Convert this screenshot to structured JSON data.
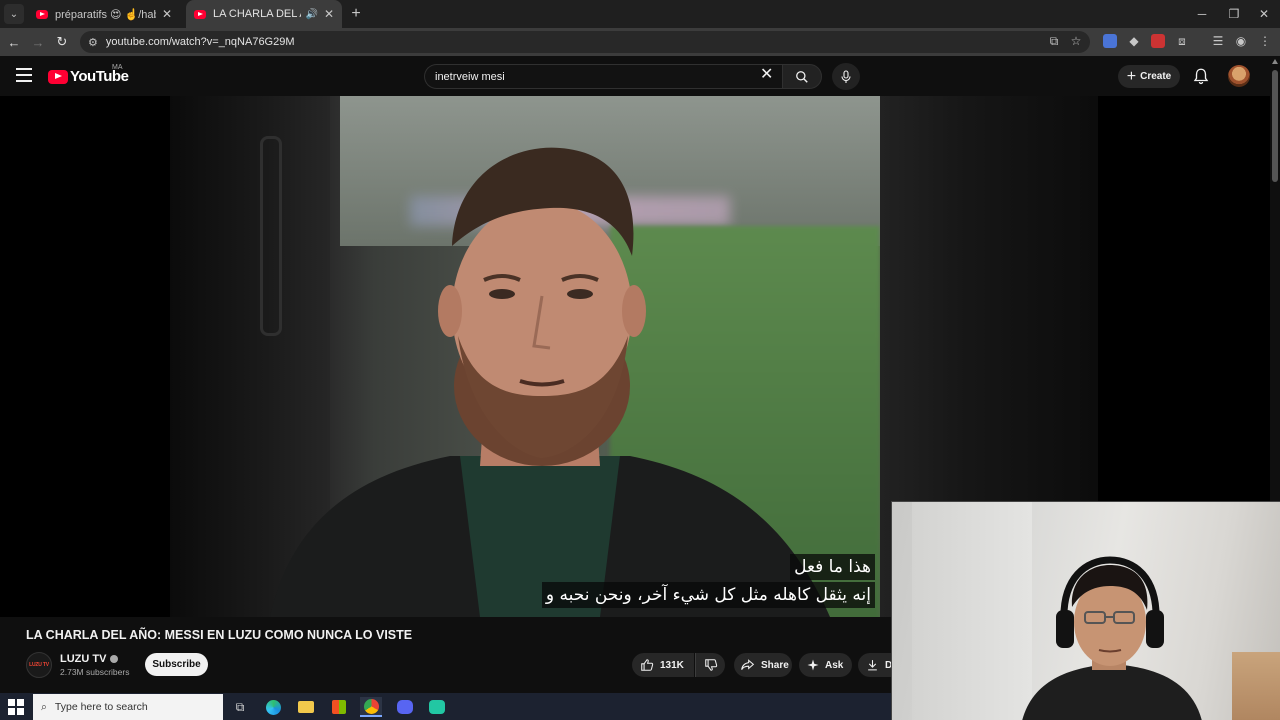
{
  "browser": {
    "tabs": [
      {
        "title": "préparatifs 😍 ☝️/habbat abdel",
        "active": false
      },
      {
        "title": "LA CHARLA DEL AÑO: MESSI",
        "active": true
      }
    ],
    "url": "youtube.com/watch?v=_nqNA76G29M",
    "new_tab_label": "+"
  },
  "youtube": {
    "logo_text": "YouTube",
    "region": "MA",
    "search": {
      "query": "inetrveiw mesi"
    },
    "create_label": "Create"
  },
  "video": {
    "subtitle_lines": [
      "هذا ما فعل",
      "إنه يثقل كاهله مثل كل شيء آخر، ونحن نحبه و"
    ],
    "title": "LA CHARLA DEL AÑO: MESSI EN LUZU COMO NUNCA LO VISTE",
    "channel": {
      "name": "LUZU TV",
      "subscribers": "2.73M subscribers",
      "avatar_text": "LUZU TV"
    },
    "subscribe_label": "Subscribe",
    "likes": "131K",
    "share_label": "Share",
    "ask_label": "Ask",
    "download_label": "D"
  },
  "taskbar": {
    "search_placeholder": "Type here to search"
  },
  "colors": {
    "accent": "#ff0033",
    "background": "#0f0f0f",
    "chrome_dark": "#1f1f1f",
    "toolbar": "#3c3c3c"
  }
}
